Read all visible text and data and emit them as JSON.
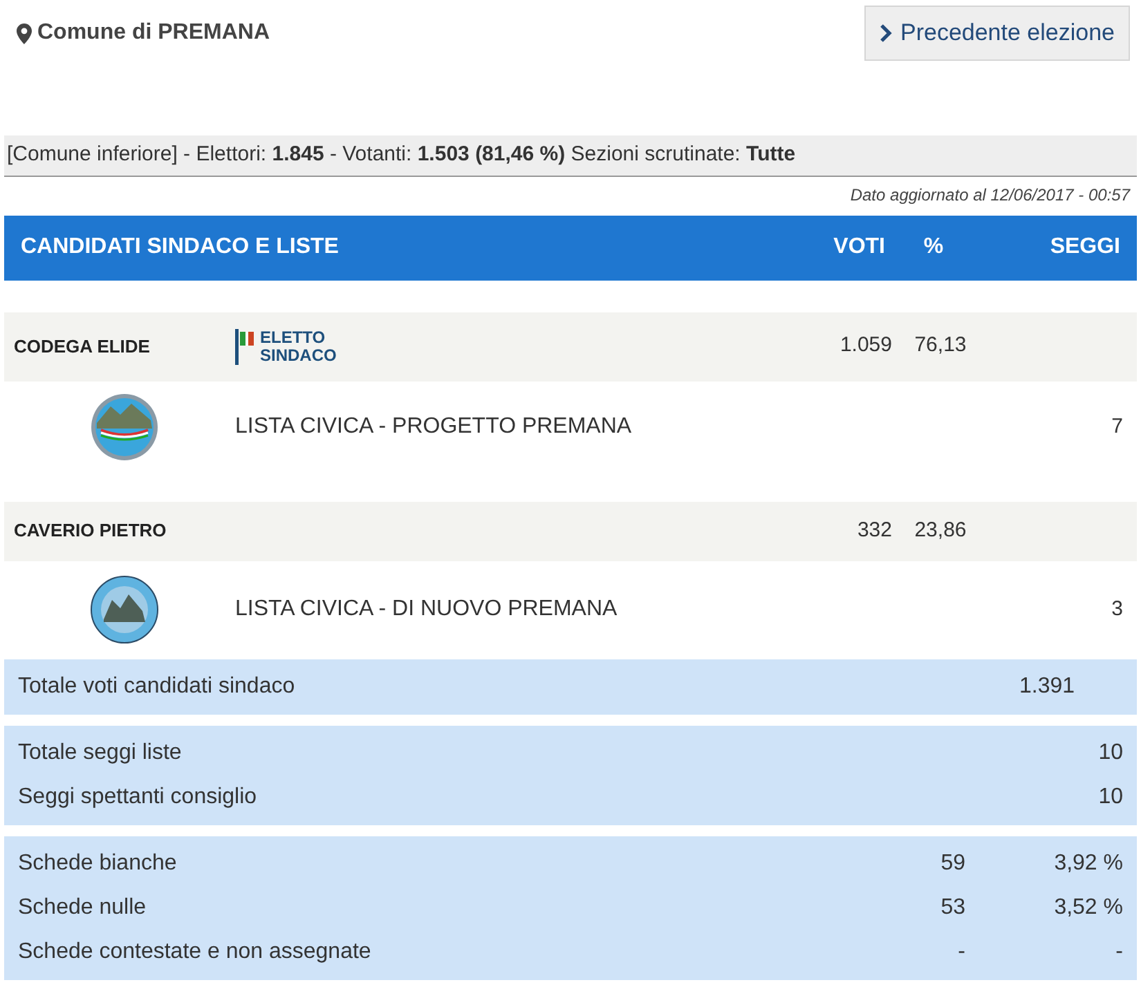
{
  "location": "Comune di PREMANA",
  "previous_button": "Precedente elezione",
  "summary": "[Comune inferiore] - Elettori: **1.845** - Votanti: **1.503**  **(81,46 %)** Sezioni scrutinate: **Tutte**",
  "updated": "Dato aggiornato al 12/06/2017 - 00:57",
  "table": {
    "columns": [
      "CANDIDATI SINDACO E LISTE",
      "VOTI",
      "%",
      "SEGGI"
    ],
    "candidates": [
      {
        "name": "CODEGA ELIDE",
        "badge": "ELETTO SINDACO",
        "votes": "1.059",
        "percent": "76,13",
        "lists": [
          {
            "name": "LISTA CIVICA - PROGETTO PREMANA",
            "seats": "7",
            "kind": "sky"
          }
        ]
      },
      {
        "name": "CAVERIO PIETRO",
        "votes": "332",
        "percent": "23,86",
        "lists": [
          {
            "name": "LISTA CIVICA - DI NUOVO PREMANA",
            "seats": "3",
            "kind": "ring"
          }
        ]
      }
    ]
  },
  "totals": [
    {
      "kind": "single",
      "rows": [
        {
          "label": "Totale voti candidati sindaco",
          "value": "1.391"
        }
      ]
    },
    {
      "kind": "seats",
      "rows": [
        {
          "label": "Totale seggi liste",
          "value": "10"
        },
        {
          "label": "Seggi spettanti consiglio",
          "value": "10"
        }
      ]
    },
    {
      "kind": "ballots",
      "rows": [
        {
          "label": "Schede bianche",
          "value": "59",
          "percent": "3,92 %"
        },
        {
          "label": "Schede nulle",
          "value": "53",
          "percent": "3,52 %"
        },
        {
          "label": "Schede contestate e non assegnate",
          "value": "-",
          "percent": "-"
        }
      ]
    }
  ]
}
